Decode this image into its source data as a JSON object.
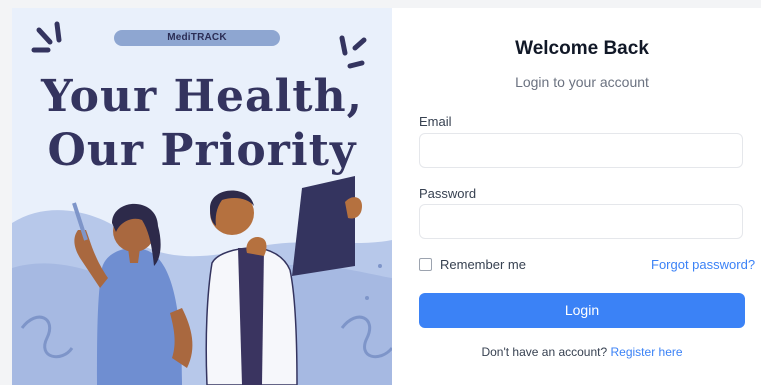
{
  "hero": {
    "brand": "MediTRACK",
    "headline_line1": "Your Health,",
    "headline_line2": "Our Priority"
  },
  "login": {
    "title": "Welcome Back",
    "subtitle": "Login to your account",
    "email_label": "Email",
    "email_value": "",
    "password_label": "Password",
    "password_value": "",
    "remember_label": "Remember me",
    "remember_checked": false,
    "forgot_label": "Forgot password?",
    "button_label": "Login",
    "register_prompt": "Don't have an account?",
    "register_link": "Register here"
  },
  "colors": {
    "accent": "#3b82f6",
    "headline": "#34345f",
    "hero_bg": "#e9f0fb"
  }
}
